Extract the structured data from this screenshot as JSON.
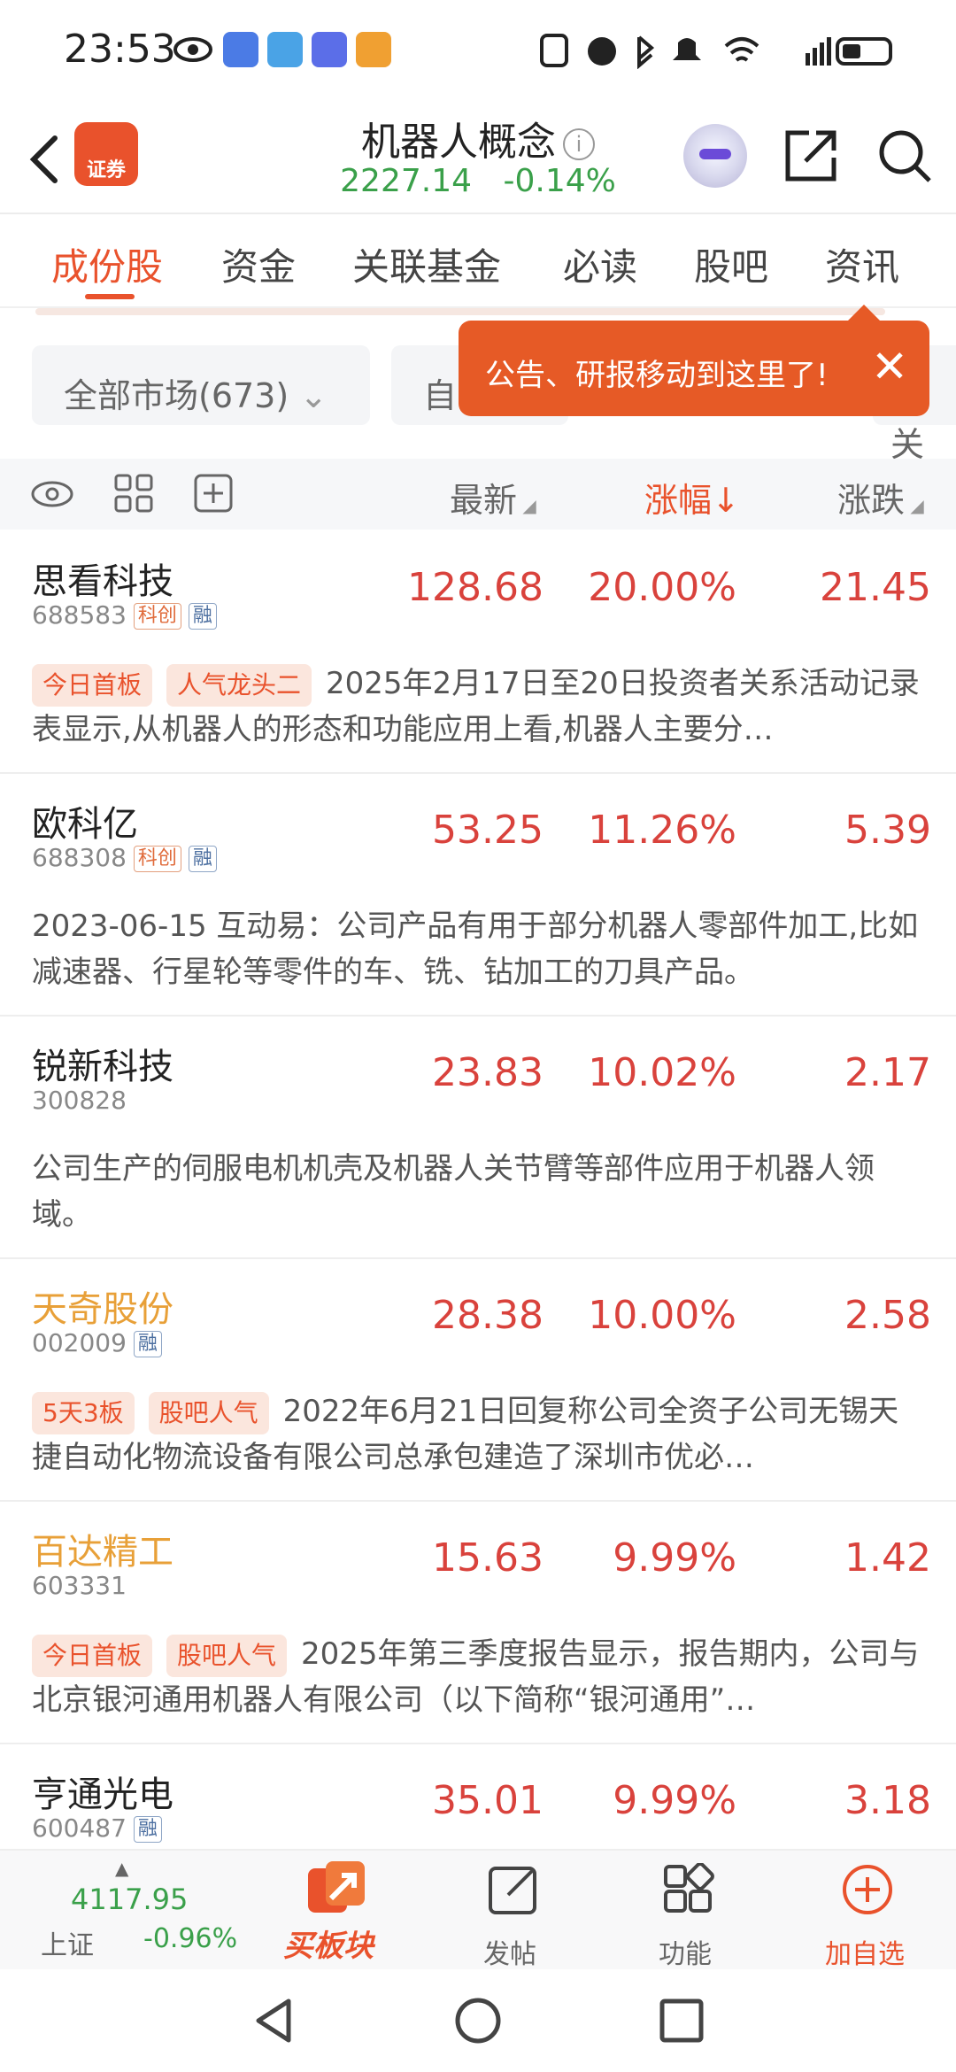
{
  "status": {
    "time": "23:53"
  },
  "header": {
    "logo_text": "证券",
    "title": "机器人概念",
    "index_value": "2227.14",
    "index_change": "-0.14%"
  },
  "tabs": [
    "成份股",
    "资金",
    "关联基金",
    "必读",
    "股吧",
    "资讯"
  ],
  "filter": {
    "market": "全部市场(673)",
    "second_partial": "自",
    "third_partial": "涉关"
  },
  "tooltip": {
    "text": "公告、研报移动到这里了!"
  },
  "table_header": {
    "latest": "最新",
    "change_pct": "涨幅",
    "change_amt": "涨跌"
  },
  "stocks": [
    {
      "name": "思看科技",
      "code": "688583",
      "badges": [
        "科创",
        "融"
      ],
      "price": "128.68",
      "pct": "20.00%",
      "chg": "21.45",
      "tags": [
        "今日首板",
        "人气龙头二"
      ],
      "desc": "2025年2月17日至20日投资者关系活动记录表显示,从机器人的形态和功能应用上看,机器人主要分…"
    },
    {
      "name": "欧科亿",
      "code": "688308",
      "badges": [
        "科创",
        "融"
      ],
      "price": "53.25",
      "pct": "11.26%",
      "chg": "5.39",
      "tags": [],
      "desc": "2023-06-15 互动易：公司产品有用于部分机器人零部件加工,比如减速器、行星轮等零件的车、铣、钻加工的刀具产品。"
    },
    {
      "name": "锐新科技",
      "code": "300828",
      "badges": [],
      "price": "23.83",
      "pct": "10.02%",
      "chg": "2.17",
      "tags": [],
      "desc": "公司生产的伺服电机机壳及机器人关节臂等部件应用于机器人领域。"
    },
    {
      "name": "天奇股份",
      "code": "002009",
      "badges": [
        "融"
      ],
      "price": "28.38",
      "pct": "10.00%",
      "chg": "2.58",
      "tags": [
        "5天3板",
        "股吧人气"
      ],
      "desc": "2022年6月21日回复称公司全资子公司无锡天捷自动化物流设备有限公司总承包建造了深圳市优必…"
    },
    {
      "name": "百达精工",
      "code": "603331",
      "badges": [],
      "price": "15.63",
      "pct": "9.99%",
      "chg": "1.42",
      "tags": [
        "今日首板",
        "股吧人气"
      ],
      "desc": "2025年第三季度报告显示，报告期内，公司与北京银河通用机器人有限公司（以下简称“银河通用”…"
    },
    {
      "name": "亨通光电",
      "code": "600487",
      "badges": [
        "融"
      ],
      "price": "35.01",
      "pct": "9.99%",
      "chg": "3.18",
      "tags": [],
      "desc": ""
    }
  ],
  "bottom": {
    "index_value": "4117.95",
    "index_name": "上证",
    "index_change": "-0.96%",
    "buy_block": "买板块",
    "post": "发帖",
    "features": "功能",
    "add_watch": "加自选"
  },
  "colors": {
    "accent": "#e9522c",
    "up": "#d9423c",
    "down": "#3aa04a",
    "hot_name": "#e8a038"
  }
}
